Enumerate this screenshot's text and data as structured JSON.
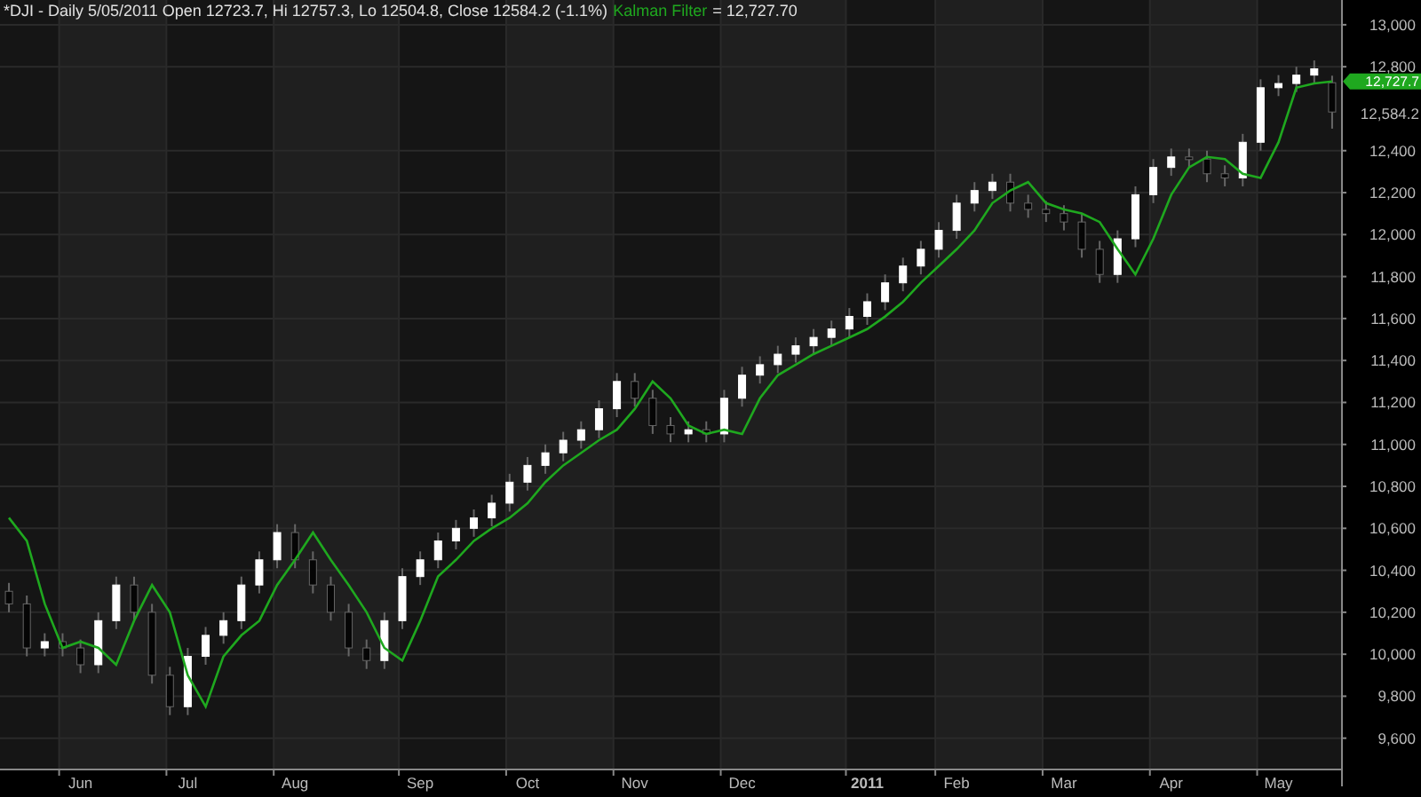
{
  "chart": {
    "header": [
      "*DJI - Daily 5/05/2011 Open 12723.7, Hi 12757.3, Lo 12504.8, Close 12584.2 (-1.1%)",
      "= 12,727.70"
    ],
    "price_tags": [
      {
        "kind": "filter",
        "text": "12,727.7",
        "color": "#1fa81f"
      },
      {
        "kind": "close",
        "text": "12,584.2"
      }
    ],
    "chart_data": {
      "type": "candlestick",
      "grid": true,
      "ylim": [
        9455,
        13118
      ],
      "categories": [
        null,
        null,
        null,
        null,
        "Jun",
        null,
        null,
        null,
        null,
        null,
        "Jul",
        null,
        null,
        null,
        null,
        null,
        "Aug",
        null,
        null,
        null,
        null,
        null,
        null,
        "Sep",
        null,
        null,
        null,
        null,
        null,
        "Oct",
        null,
        null,
        null,
        null,
        null,
        "Nov",
        null,
        null,
        null,
        null,
        null,
        "Dec",
        null,
        null,
        null,
        null,
        null,
        null,
        "2011",
        null,
        null,
        null,
        null,
        "Feb",
        null,
        null,
        null,
        null,
        null,
        "Mar",
        null,
        null,
        null,
        null,
        null,
        "Apr",
        null,
        null,
        null,
        null,
        null,
        "May",
        null,
        null,
        null
      ],
      "ohlc": [
        [
          10300,
          10340,
          10200,
          10240
        ],
        [
          10240,
          10280,
          9990,
          10030
        ],
        [
          10030,
          10100,
          9990,
          10060
        ],
        [
          10060,
          10100,
          9990,
          10030
        ],
        [
          10030,
          10070,
          9910,
          9950
        ],
        [
          9950,
          10200,
          9910,
          10160
        ],
        [
          10160,
          10370,
          10120,
          10330
        ],
        [
          10330,
          10370,
          10160,
          10200
        ],
        [
          10200,
          10240,
          9860,
          9900
        ],
        [
          9900,
          9940,
          9710,
          9750
        ],
        [
          9750,
          10030,
          9710,
          9990
        ],
        [
          9990,
          10130,
          9950,
          10090
        ],
        [
          10090,
          10200,
          10050,
          10160
        ],
        [
          10160,
          10370,
          10120,
          10330
        ],
        [
          10330,
          10490,
          10290,
          10450
        ],
        [
          10450,
          10620,
          10410,
          10580
        ],
        [
          10580,
          10620,
          10410,
          10450
        ],
        [
          10450,
          10490,
          10290,
          10330
        ],
        [
          10330,
          10370,
          10160,
          10200
        ],
        [
          10200,
          10240,
          9990,
          10030
        ],
        [
          10030,
          10070,
          9930,
          9970
        ],
        [
          9970,
          10200,
          9930,
          10160
        ],
        [
          10160,
          10410,
          10120,
          10370
        ],
        [
          10370,
          10490,
          10330,
          10450
        ],
        [
          10450,
          10580,
          10410,
          10540
        ],
        [
          10540,
          10640,
          10500,
          10600
        ],
        [
          10600,
          10690,
          10560,
          10650
        ],
        [
          10650,
          10760,
          10610,
          10720
        ],
        [
          10720,
          10860,
          10680,
          10820
        ],
        [
          10820,
          10940,
          10780,
          10900
        ],
        [
          10900,
          11000,
          10860,
          10960
        ],
        [
          10960,
          11060,
          10920,
          11020
        ],
        [
          11020,
          11110,
          10980,
          11070
        ],
        [
          11070,
          11210,
          11030,
          11170
        ],
        [
          11170,
          11340,
          11130,
          11300
        ],
        [
          11300,
          11340,
          11180,
          11220
        ],
        [
          11220,
          11260,
          11050,
          11090
        ],
        [
          11090,
          11130,
          11010,
          11050
        ],
        [
          11050,
          11110,
          11010,
          11070
        ],
        [
          11070,
          11110,
          11010,
          11050
        ],
        [
          11050,
          11260,
          11010,
          11220
        ],
        [
          11220,
          11370,
          11180,
          11330
        ],
        [
          11330,
          11420,
          11290,
          11380
        ],
        [
          11380,
          11470,
          11340,
          11430
        ],
        [
          11430,
          11510,
          11390,
          11470
        ],
        [
          11470,
          11550,
          11430,
          11510
        ],
        [
          11510,
          11590,
          11470,
          11550
        ],
        [
          11550,
          11650,
          11510,
          11610
        ],
        [
          11610,
          11720,
          11570,
          11680
        ],
        [
          11680,
          11810,
          11640,
          11770
        ],
        [
          11770,
          11890,
          11730,
          11850
        ],
        [
          11850,
          11970,
          11810,
          11930
        ],
        [
          11930,
          12060,
          11890,
          12020
        ],
        [
          12020,
          12190,
          11980,
          12150
        ],
        [
          12150,
          12250,
          12110,
          12210
        ],
        [
          12210,
          12290,
          12170,
          12250
        ],
        [
          12250,
          12290,
          12110,
          12150
        ],
        [
          12150,
          12190,
          12080,
          12120
        ],
        [
          12120,
          12160,
          12060,
          12100
        ],
        [
          12100,
          12140,
          12020,
          12060
        ],
        [
          12060,
          12100,
          11890,
          11930
        ],
        [
          11930,
          11970,
          11770,
          11810
        ],
        [
          11810,
          12020,
          11770,
          11980
        ],
        [
          11980,
          12230,
          11940,
          12190
        ],
        [
          12190,
          12360,
          12150,
          12320
        ],
        [
          12320,
          12410,
          12280,
          12370
        ],
        [
          12370,
          12410,
          12320,
          12360
        ],
        [
          12360,
          12400,
          12250,
          12290
        ],
        [
          12290,
          12330,
          12230,
          12270
        ],
        [
          12270,
          12480,
          12230,
          12440
        ],
        [
          12440,
          12740,
          12400,
          12700
        ],
        [
          12700,
          12760,
          12660,
          12720
        ],
        [
          12720,
          12800,
          12680,
          12760
        ],
        [
          12760,
          12830,
          12720,
          12790
        ],
        [
          12723.7,
          12757.3,
          12504.8,
          12584.2
        ]
      ],
      "series": [
        {
          "name": "Kalman Filter",
          "type": "line",
          "color": "#1fa81f",
          "values": [
            10650,
            10540,
            10240,
            10030,
            10060,
            10030,
            9950,
            10160,
            10330,
            10200,
            9900,
            9750,
            9990,
            10090,
            10160,
            10330,
            10450,
            10580,
            10450,
            10330,
            10200,
            10030,
            9970,
            10160,
            10370,
            10450,
            10540,
            10600,
            10650,
            10720,
            10820,
            10900,
            10960,
            11020,
            11070,
            11170,
            11300,
            11220,
            11090,
            11050,
            11070,
            11050,
            11220,
            11330,
            11380,
            11430,
            11470,
            11510,
            11550,
            11610,
            11680,
            11770,
            11850,
            11930,
            12020,
            12150,
            12210,
            12250,
            12150,
            12120,
            12100,
            12060,
            11930,
            11810,
            11980,
            12190,
            12320,
            12370,
            12360,
            12290,
            12270,
            12440,
            12700,
            12720,
            12730
          ]
        }
      ],
      "yticks": [
        {
          "value": 9600,
          "label": "9,600"
        },
        {
          "value": 9800,
          "label": "9,800"
        },
        {
          "value": 10000,
          "label": "10,000"
        },
        {
          "value": 10200,
          "label": "10,200"
        },
        {
          "value": 10400,
          "label": "10,400"
        },
        {
          "value": 10600,
          "label": "10,600"
        },
        {
          "value": 10800,
          "label": "10,800"
        },
        {
          "value": 11000,
          "label": "11,000"
        },
        {
          "value": 11200,
          "label": "11,200"
        },
        {
          "value": 11400,
          "label": "11,400"
        },
        {
          "value": 11600,
          "label": "11,600"
        },
        {
          "value": 11800,
          "label": "11,800"
        },
        {
          "value": 12000,
          "label": "12,000"
        },
        {
          "value": 12200,
          "label": "12,200"
        },
        {
          "value": 12400,
          "label": "12,400"
        },
        {
          "value": 12800,
          "label": "12,800"
        },
        {
          "value": 13000,
          "label": "13,000"
        }
      ]
    }
  }
}
